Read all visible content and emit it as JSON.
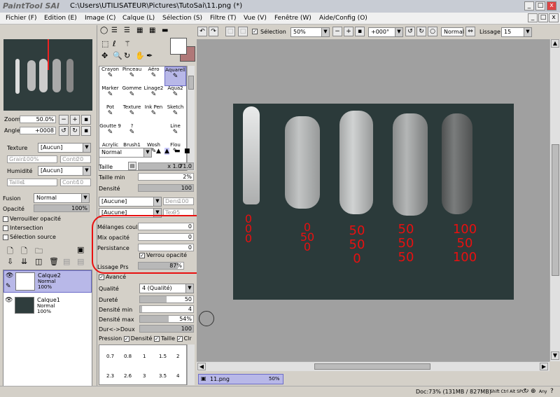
{
  "app": {
    "logo": "PaintTool SAI",
    "title": "C:\\Users\\UTILISATEUR\\Pictures\\TutoSai\\11.png (*)"
  },
  "menu": [
    "Fichier (F)",
    "Edition (E)",
    "Image (C)",
    "Calque (L)",
    "Sélection (S)",
    "Filtre (T)",
    "Vue (V)",
    "Fenêtre (W)",
    "Aide/Config (O)"
  ],
  "toolbar": {
    "selection_label": "Sélection",
    "zoom": "50%",
    "rotation": "+000°",
    "blend": "Normal",
    "smoothing_label": "Lissage",
    "smoothing": "15"
  },
  "navigator": {
    "zoom_label": "Zoom",
    "zoom": "50.0%",
    "angle_label": "Angle",
    "angle": "+0008"
  },
  "texture": {
    "texture_label": "Texture",
    "texture_value": "[Aucun]",
    "grain_label": "Grain",
    "grain": "100%",
    "contr_label": "Contr",
    "contr": "20",
    "humidity_label": "Humidité",
    "humidity_value": "[Aucun]",
    "size_label": "Taille",
    "size": "1",
    "contr2": "10"
  },
  "layer_props": {
    "fusion_label": "Fusion",
    "fusion": "Normal",
    "opacity_label": "Opacité",
    "opacity": "100%",
    "lock_opacity": "Verrouiller opacité",
    "intersection": "Intersection",
    "source": "Sélection source"
  },
  "layers": [
    {
      "name": "Calque2",
      "mode": "Normal",
      "opacity": "100%"
    },
    {
      "name": "Calque1",
      "mode": "Normal",
      "opacity": "100%"
    }
  ],
  "tools": [
    [
      "Crayon",
      "Pinceau",
      "Aéro",
      "Aquarell"
    ],
    [
      "Marker",
      "Gomme",
      "Linage2",
      "Aqua2"
    ],
    [
      "Pot",
      "Texture",
      "Ink Pen",
      "Sketch"
    ],
    [
      "Goutte 9",
      "?",
      "",
      "Line"
    ],
    [
      "Acrylic",
      "Brush1",
      "Wosh",
      "Flou"
    ]
  ],
  "brush": {
    "mode": "Normal",
    "size_label": "Taille",
    "size_mult": "x 1.0",
    "size": "71.0",
    "min_size_label": "Taille min",
    "min_size": "2%",
    "density_label": "Densité",
    "density": "100",
    "shape1": "[Aucune]",
    "shape1_label": "Dens",
    "shape1_val": "100",
    "shape2": "[Aucune]",
    "shape2_label": "Tex",
    "shape2_val": "95",
    "blend_label": "Mélanges coul",
    "blend": "0",
    "mix_label": "Mix opacité",
    "mix": "0",
    "persist_label": "Persistance",
    "persist": "0",
    "lock_opacity": "Verrou opacité",
    "smooth_label": "Lissage Prs",
    "smooth": "87%",
    "advanced": "Avancé",
    "quality_label": "Qualité",
    "quality": "4 (Qualité)",
    "hardness_label": "Dureté",
    "hardness": "50",
    "min_density_label": "Densité min",
    "min_density": "4",
    "max_density_label": "Densité max",
    "max_density": "54%",
    "hard_soft_label": "Dur<->Doux",
    "hard_soft": "100",
    "pressure_label": "Pression",
    "p_density": "Densité",
    "p_size": "Taille",
    "p_clr": "Clr",
    "dots": [
      "0.7",
      "0.8",
      "1",
      "1.5",
      "2",
      "2.3",
      "2.6",
      "3",
      "3.5",
      "4"
    ]
  },
  "canvas": {
    "annotations": [
      [
        "0",
        "0",
        "0"
      ],
      [
        "0",
        "50",
        "0"
      ],
      [
        "50",
        "50",
        "0"
      ],
      [
        "50",
        "50",
        "50"
      ],
      [
        "100",
        "50",
        "100"
      ]
    ]
  },
  "status": {
    "tab": "11.png",
    "tab_zoom": "50%",
    "doc": "Doc:73% (131MB / 827MB)",
    "keys": "Shift Ctrl Alt SPC",
    "any": "Any"
  },
  "colors": {
    "canvas": "#2b3a3a",
    "highlight": "#e81010",
    "selected": "#b8b8e8"
  }
}
